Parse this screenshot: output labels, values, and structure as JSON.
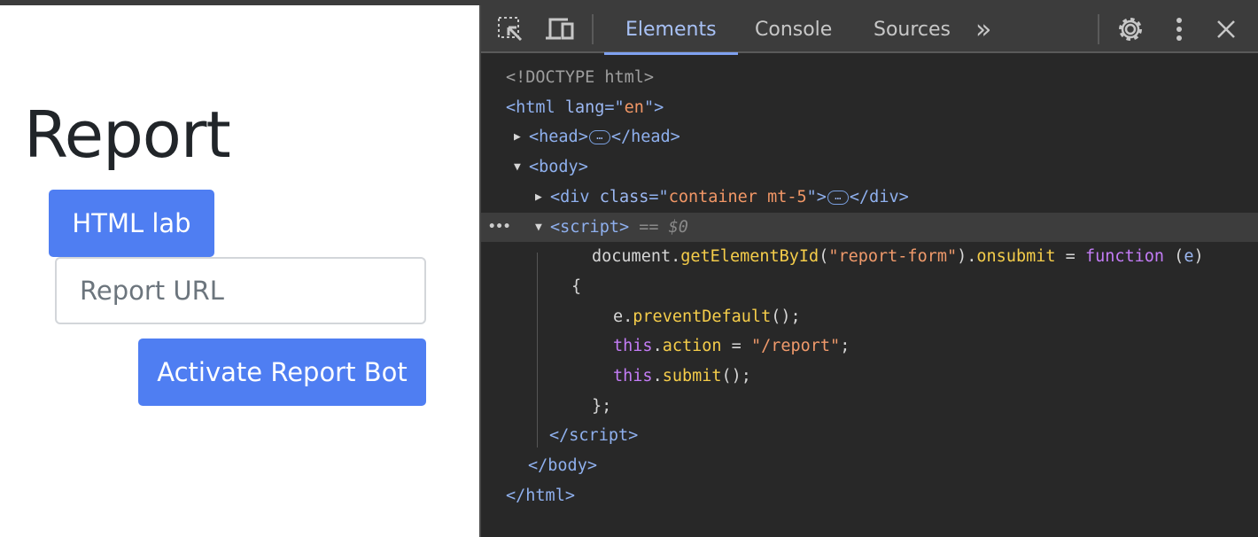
{
  "page": {
    "title": "Report",
    "html_lab_button": "HTML lab",
    "report_url_placeholder": "Report URL",
    "activate_button": "Activate Report Bot"
  },
  "devtools": {
    "tabs": [
      "Elements",
      "Console",
      "Sources"
    ],
    "more_tabs": "»",
    "selected_marker": "== $0",
    "lines": [
      [
        [
          "t-gray",
          "<!DOCTYPE html>"
        ]
      ],
      [
        [
          "t-tag",
          "<html "
        ],
        [
          "t-attr",
          "lang"
        ],
        [
          "t-tag",
          "=\""
        ],
        [
          "t-val",
          "en"
        ],
        [
          "t-tag",
          "\">"
        ]
      ],
      [
        [
          "t-tag",
          "<head>"
        ],
        [
          "ell",
          "…"
        ],
        [
          "t-tag",
          "</head>"
        ]
      ],
      [
        [
          "t-tag",
          "<body>"
        ]
      ],
      [
        [
          "t-tag",
          "<div "
        ],
        [
          "t-attr",
          "class"
        ],
        [
          "t-tag",
          "=\""
        ],
        [
          "t-val",
          "container mt-5"
        ],
        [
          "t-tag",
          "\">"
        ],
        [
          "ell",
          "…"
        ],
        [
          "t-tag",
          "</div>"
        ]
      ],
      [
        [
          "t-tag",
          "<script>"
        ],
        [
          "t-ital",
          " == $0"
        ]
      ],
      [
        [
          "t-txt",
          "document."
        ],
        [
          "t-fn",
          "getElementById"
        ],
        [
          "t-txt",
          "("
        ],
        [
          "t-str",
          "\"report-form\""
        ],
        [
          "t-txt",
          ")."
        ],
        [
          "t-fn",
          "onsubmit"
        ],
        [
          "t-txt",
          " = "
        ],
        [
          "t-kw",
          "function"
        ],
        [
          "t-txt",
          " ("
        ],
        [
          "t-attr",
          "e"
        ],
        [
          "t-txt",
          ")"
        ]
      ],
      [
        [
          "t-txt",
          "{"
        ]
      ],
      [
        [
          "t-txt",
          "e."
        ],
        [
          "t-fn",
          "preventDefault"
        ],
        [
          "t-txt",
          "();"
        ]
      ],
      [
        [
          "t-kw",
          "this"
        ],
        [
          "t-txt",
          "."
        ],
        [
          "t-fn",
          "action"
        ],
        [
          "t-txt",
          " = "
        ],
        [
          "t-str",
          "\"/report\""
        ],
        [
          "t-txt",
          ";"
        ]
      ],
      [
        [
          "t-kw",
          "this"
        ],
        [
          "t-txt",
          "."
        ],
        [
          "t-fn",
          "submit"
        ],
        [
          "t-txt",
          "();"
        ]
      ],
      [
        [
          "t-txt",
          "};"
        ]
      ],
      [
        [
          "t-tag",
          "</script>"
        ]
      ],
      [
        [
          "t-tag",
          "</body>"
        ]
      ],
      [
        [
          "t-tag",
          "</html>"
        ]
      ]
    ]
  }
}
